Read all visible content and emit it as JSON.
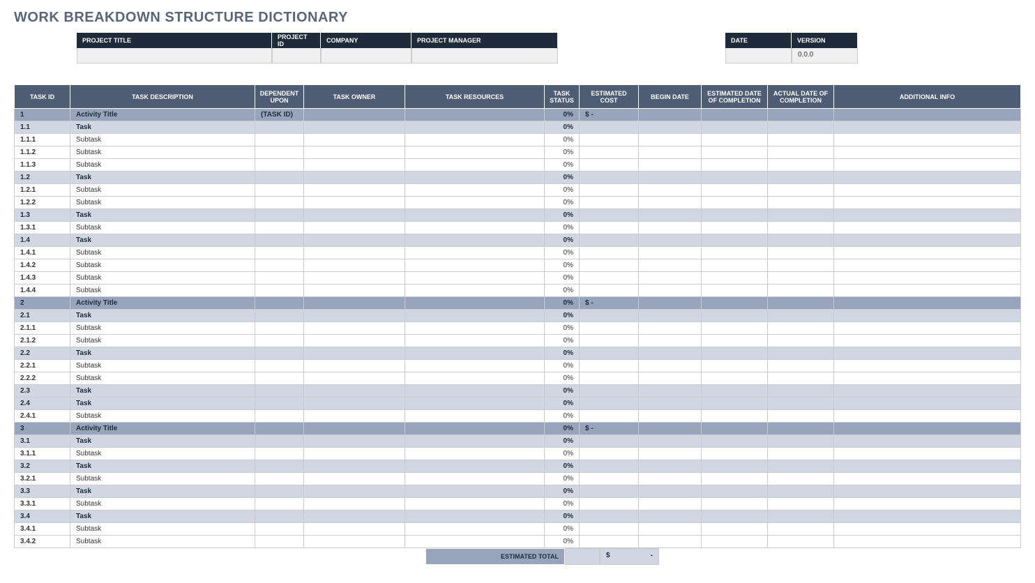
{
  "title": "WORK BREAKDOWN STRUCTURE DICTIONARY",
  "meta": {
    "headers": {
      "project_title": "PROJECT TITLE",
      "project_id": "PROJECT ID",
      "company": "COMPANY",
      "project_manager": "PROJECT MANAGER",
      "date": "DATE",
      "version": "VERSION"
    },
    "values": {
      "project_title": "",
      "project_id": "",
      "company": "",
      "project_manager": "",
      "date": "",
      "version": "0.0.0"
    }
  },
  "columns": {
    "task_id": "TASK ID",
    "task_description": "TASK DESCRIPTION",
    "dependent_upon": "DEPENDENT UPON",
    "task_owner": "TASK OWNER",
    "task_resources": "TASK RESOURCES",
    "task_status": "TASK STATUS",
    "estimated_cost": "ESTIMATED COST",
    "begin_date": "BEGIN DATE",
    "est_completion": "ESTIMATED DATE OF COMPLETION",
    "actual_completion": "ACTUAL DATE OF COMPLETION",
    "additional_info": "ADDITIONAL INFO"
  },
  "rows": [
    {
      "id": "1",
      "desc": "Activity Title",
      "dep": "(TASK ID)",
      "status": "0%",
      "cost": "$        -",
      "level": "activity"
    },
    {
      "id": "1.1",
      "desc": "Task",
      "dep": "",
      "status": "0%",
      "cost": "",
      "level": "task"
    },
    {
      "id": "1.1.1",
      "desc": "Subtask",
      "dep": "",
      "status": "0%",
      "cost": "",
      "level": "subtask"
    },
    {
      "id": "1.1.2",
      "desc": "Subtask",
      "dep": "",
      "status": "0%",
      "cost": "",
      "level": "subtask"
    },
    {
      "id": "1.1.3",
      "desc": "Subtask",
      "dep": "",
      "status": "0%",
      "cost": "",
      "level": "subtask"
    },
    {
      "id": "1.2",
      "desc": "Task",
      "dep": "",
      "status": "0%",
      "cost": "",
      "level": "task"
    },
    {
      "id": "1.2.1",
      "desc": "Subtask",
      "dep": "",
      "status": "0%",
      "cost": "",
      "level": "subtask"
    },
    {
      "id": "1.2.2",
      "desc": "Subtask",
      "dep": "",
      "status": "0%",
      "cost": "",
      "level": "subtask"
    },
    {
      "id": "1.3",
      "desc": "Task",
      "dep": "",
      "status": "0%",
      "cost": "",
      "level": "task"
    },
    {
      "id": "1.3.1",
      "desc": "Subtask",
      "dep": "",
      "status": "0%",
      "cost": "",
      "level": "subtask"
    },
    {
      "id": "1.4",
      "desc": "Task",
      "dep": "",
      "status": "0%",
      "cost": "",
      "level": "task"
    },
    {
      "id": "1.4.1",
      "desc": "Subtask",
      "dep": "",
      "status": "0%",
      "cost": "",
      "level": "subtask"
    },
    {
      "id": "1.4.2",
      "desc": "Subtask",
      "dep": "",
      "status": "0%",
      "cost": "",
      "level": "subtask"
    },
    {
      "id": "1.4.3",
      "desc": "Subtask",
      "dep": "",
      "status": "0%",
      "cost": "",
      "level": "subtask"
    },
    {
      "id": "1.4.4",
      "desc": "Subtask",
      "dep": "",
      "status": "0%",
      "cost": "",
      "level": "subtask"
    },
    {
      "id": "2",
      "desc": "Activity Title",
      "dep": "",
      "status": "0%",
      "cost": "$        -",
      "level": "activity"
    },
    {
      "id": "2.1",
      "desc": "Task",
      "dep": "",
      "status": "0%",
      "cost": "",
      "level": "task"
    },
    {
      "id": "2.1.1",
      "desc": "Subtask",
      "dep": "",
      "status": "0%",
      "cost": "",
      "level": "subtask"
    },
    {
      "id": "2.1.2",
      "desc": "Subtask",
      "dep": "",
      "status": "0%",
      "cost": "",
      "level": "subtask"
    },
    {
      "id": "2.2",
      "desc": "Task",
      "dep": "",
      "status": "0%",
      "cost": "",
      "level": "task"
    },
    {
      "id": "2.2.1",
      "desc": "Subtask",
      "dep": "",
      "status": "0%",
      "cost": "",
      "level": "subtask"
    },
    {
      "id": "2.2.2",
      "desc": "Subtask",
      "dep": "",
      "status": "0%",
      "cost": "",
      "level": "subtask"
    },
    {
      "id": "2.3",
      "desc": "Task",
      "dep": "",
      "status": "0%",
      "cost": "",
      "level": "task"
    },
    {
      "id": "2.4",
      "desc": "Task",
      "dep": "",
      "status": "0%",
      "cost": "",
      "level": "task"
    },
    {
      "id": "2.4.1",
      "desc": "Subtask",
      "dep": "",
      "status": "0%",
      "cost": "",
      "level": "subtask"
    },
    {
      "id": "3",
      "desc": "Activity Title",
      "dep": "",
      "status": "0%",
      "cost": "$        -",
      "level": "activity"
    },
    {
      "id": "3.1",
      "desc": "Task",
      "dep": "",
      "status": "0%",
      "cost": "",
      "level": "task"
    },
    {
      "id": "3.1.1",
      "desc": "Subtask",
      "dep": "",
      "status": "0%",
      "cost": "",
      "level": "subtask"
    },
    {
      "id": "3.2",
      "desc": "Task",
      "dep": "",
      "status": "0%",
      "cost": "",
      "level": "task"
    },
    {
      "id": "3.2.1",
      "desc": "Subtask",
      "dep": "",
      "status": "0%",
      "cost": "",
      "level": "subtask"
    },
    {
      "id": "3.3",
      "desc": "Task",
      "dep": "",
      "status": "0%",
      "cost": "",
      "level": "task"
    },
    {
      "id": "3.3.1",
      "desc": "Subtask",
      "dep": "",
      "status": "0%",
      "cost": "",
      "level": "subtask"
    },
    {
      "id": "3.4",
      "desc": "Task",
      "dep": "",
      "status": "0%",
      "cost": "",
      "level": "task"
    },
    {
      "id": "3.4.1",
      "desc": "Subtask",
      "dep": "",
      "status": "0%",
      "cost": "",
      "level": "subtask"
    },
    {
      "id": "3.4.2",
      "desc": "Subtask",
      "dep": "",
      "status": "0%",
      "cost": "",
      "level": "subtask"
    }
  ],
  "total": {
    "label": "ESTIMATED TOTAL",
    "symbol": "$",
    "value": "-"
  }
}
